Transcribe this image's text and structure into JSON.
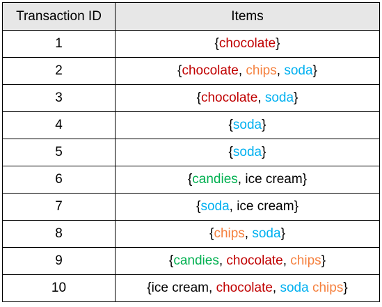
{
  "colors": {
    "chocolate": "#c00000",
    "chips": "#f5813f",
    "soda": "#00b0f0",
    "candies": "#00b050",
    "ice cream": "#000000",
    "brace": "#000000"
  },
  "header": {
    "id": "Transaction ID",
    "items": "Items"
  },
  "rows": [
    {
      "id": "1",
      "parts": [
        {
          "t": "{"
        },
        {
          "t": "chocolate",
          "k": "chocolate"
        },
        {
          "t": "}"
        }
      ]
    },
    {
      "id": "2",
      "parts": [
        {
          "t": "{"
        },
        {
          "t": "chocolate",
          "k": "chocolate"
        },
        {
          "t": ", "
        },
        {
          "t": "chips",
          "k": "chips"
        },
        {
          "t": ", "
        },
        {
          "t": "soda",
          "k": "soda"
        },
        {
          "t": "}"
        }
      ]
    },
    {
      "id": "3",
      "parts": [
        {
          "t": "{"
        },
        {
          "t": "chocolate",
          "k": "chocolate"
        },
        {
          "t": ", "
        },
        {
          "t": "soda",
          "k": "soda"
        },
        {
          "t": "}"
        }
      ]
    },
    {
      "id": "4",
      "parts": [
        {
          "t": "{"
        },
        {
          "t": "soda",
          "k": "soda"
        },
        {
          "t": "}"
        }
      ]
    },
    {
      "id": "5",
      "parts": [
        {
          "t": "{"
        },
        {
          "t": "soda",
          "k": "soda"
        },
        {
          "t": "}"
        }
      ]
    },
    {
      "id": "6",
      "parts": [
        {
          "t": "{"
        },
        {
          "t": "candies",
          "k": "candies"
        },
        {
          "t": ", "
        },
        {
          "t": "ice cream",
          "k": "ice cream"
        },
        {
          "t": "}"
        }
      ]
    },
    {
      "id": "7",
      "parts": [
        {
          "t": "{"
        },
        {
          "t": "soda",
          "k": "soda"
        },
        {
          "t": ", "
        },
        {
          "t": "ice cream",
          "k": "ice cream"
        },
        {
          "t": "}"
        }
      ]
    },
    {
      "id": "8",
      "parts": [
        {
          "t": "{"
        },
        {
          "t": "chips",
          "k": "chips"
        },
        {
          "t": ", "
        },
        {
          "t": "soda",
          "k": "soda"
        },
        {
          "t": "}"
        }
      ]
    },
    {
      "id": "9",
      "parts": [
        {
          "t": "{"
        },
        {
          "t": "candies",
          "k": "candies"
        },
        {
          "t": ", "
        },
        {
          "t": "chocolate",
          "k": "chocolate"
        },
        {
          "t": ", "
        },
        {
          "t": "chips",
          "k": "chips"
        },
        {
          "t": "}"
        }
      ]
    },
    {
      "id": "10",
      "parts": [
        {
          "t": "{"
        },
        {
          "t": "ice cream",
          "k": "ice cream"
        },
        {
          "t": ", "
        },
        {
          "t": "chocolate",
          "k": "chocolate"
        },
        {
          "t": ", "
        },
        {
          "t": "soda",
          "k": "soda"
        },
        {
          "t": " "
        },
        {
          "t": "chips",
          "k": "chips"
        },
        {
          "t": "}"
        }
      ]
    }
  ]
}
